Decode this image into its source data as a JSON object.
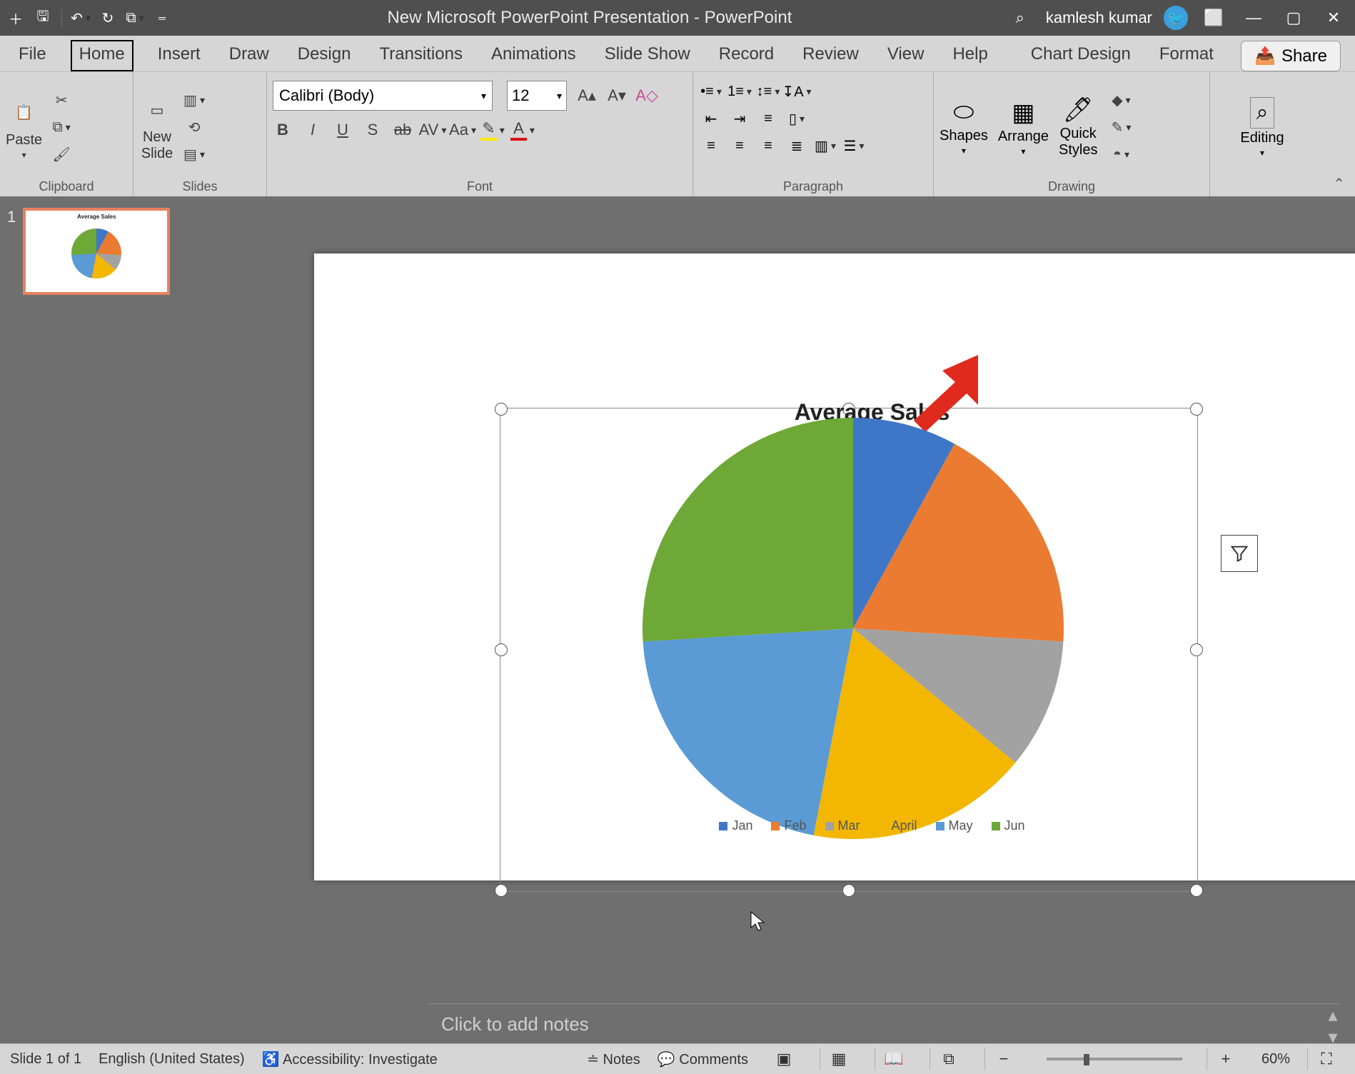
{
  "title": "New Microsoft PowerPoint Presentation  -  PowerPoint",
  "user_name": "kamlesh kumar",
  "qat": {
    "autosave": "add",
    "save": "save",
    "undo": "↶",
    "redo": "↻",
    "start": "▷"
  },
  "tabs": [
    "File",
    "Home",
    "Insert",
    "Draw",
    "Design",
    "Transitions",
    "Animations",
    "Slide Show",
    "Record",
    "Review",
    "View",
    "Help",
    "Chart Design",
    "Format"
  ],
  "active_tab_index": 1,
  "share_label": "Share",
  "ribbon": {
    "clipboard": {
      "label": "Clipboard",
      "paste": "Paste"
    },
    "slides": {
      "label": "Slides",
      "new_slide": "New\nSlide"
    },
    "font": {
      "label": "Font",
      "name": "Calibri (Body)",
      "size": "12"
    },
    "paragraph": {
      "label": "Paragraph"
    },
    "drawing": {
      "label": "Drawing",
      "shapes": "Shapes",
      "arrange": "Arrange",
      "quick_styles": "Quick\nStyles"
    },
    "editing": {
      "label": "Editing",
      "editing": "Editing"
    }
  },
  "thumb": {
    "index": "1"
  },
  "notes_placeholder": "Click to add notes",
  "status": {
    "slide_of": "Slide 1 of 1",
    "language": "English (United States)",
    "accessibility": "Accessibility: Investigate",
    "notes_btn": "Notes",
    "comments_btn": "Comments",
    "zoom": "60%"
  },
  "chart_data": {
    "type": "pie",
    "title": "Average Sales",
    "categories": [
      "Jan",
      "Feb",
      "Mar",
      "April",
      "May",
      "Jun"
    ],
    "values": [
      8,
      18,
      10,
      17,
      21,
      26
    ],
    "colors": [
      "#3f77c8",
      "#ea7b31",
      "#a2a2a2",
      "#f3b701",
      "#5a9bd5",
      "#6ea836"
    ],
    "legend_position": "bottom"
  },
  "filter_icon": "filter-icon"
}
